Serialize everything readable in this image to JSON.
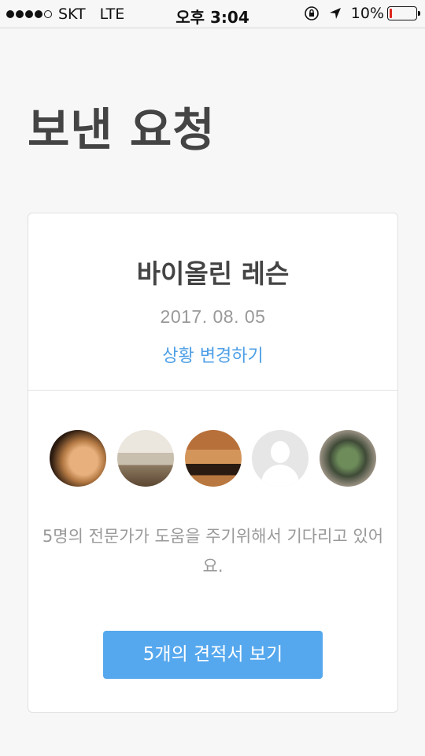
{
  "status_bar": {
    "carrier": "SKT",
    "network": "LTE",
    "time": "오후 3:04",
    "battery_text": "10%",
    "battery_level": 0.1,
    "signal_bars_filled": 4,
    "signal_bars_total": 5,
    "icons": [
      "rotation-lock-icon",
      "location-arrow-icon",
      "battery-icon"
    ]
  },
  "page": {
    "title": "보낸 요청"
  },
  "request_card": {
    "title": "바이올린 레슨",
    "date": "2017. 08. 05",
    "change_status_label": "상황 변경하기",
    "experts": [
      {
        "avatar": "violinist-photo"
      },
      {
        "avatar": "piano-hall-photo"
      },
      {
        "avatar": "violin-piano-photo"
      },
      {
        "avatar": "default-person-placeholder"
      },
      {
        "avatar": "ensemble-photo"
      }
    ],
    "waiting_message": "5명의 전문가가 도움을 주기위해서 기다리고 있어요.",
    "view_quotes_label": "5개의 견적서 보기"
  },
  "colors": {
    "accent_link": "#4d9fe6",
    "button_bg": "#56a8ee",
    "battery_low": "#e0241b"
  }
}
